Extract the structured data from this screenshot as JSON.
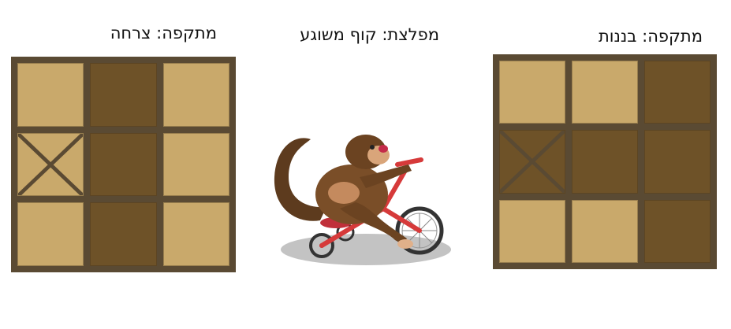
{
  "labels": {
    "left": "מתקפה: צרחה",
    "center": "מפלצת: קוף משוגע",
    "right": "מתקפה: בננות"
  },
  "boards": {
    "left": {
      "cells": [
        {
          "shade": "light",
          "mark": ""
        },
        {
          "shade": "dark",
          "mark": ""
        },
        {
          "shade": "light",
          "mark": ""
        },
        {
          "shade": "light",
          "mark": "x"
        },
        {
          "shade": "dark",
          "mark": ""
        },
        {
          "shade": "light",
          "mark": ""
        },
        {
          "shade": "light",
          "mark": ""
        },
        {
          "shade": "dark",
          "mark": ""
        },
        {
          "shade": "light",
          "mark": ""
        }
      ]
    },
    "right": {
      "cells": [
        {
          "shade": "light",
          "mark": ""
        },
        {
          "shade": "light",
          "mark": ""
        },
        {
          "shade": "dark",
          "mark": ""
        },
        {
          "shade": "dark",
          "mark": "x"
        },
        {
          "shade": "dark",
          "mark": ""
        },
        {
          "shade": "dark",
          "mark": ""
        },
        {
          "shade": "light",
          "mark": ""
        },
        {
          "shade": "light",
          "mark": ""
        },
        {
          "shade": "dark",
          "mark": ""
        }
      ]
    }
  },
  "colors": {
    "frame": "#5a4a33",
    "light_cell": "#c9a96b",
    "dark_cell": "#6e5228",
    "mark": "#5a4a33"
  },
  "monster": {
    "icon": "monkey-on-tricycle-icon"
  }
}
